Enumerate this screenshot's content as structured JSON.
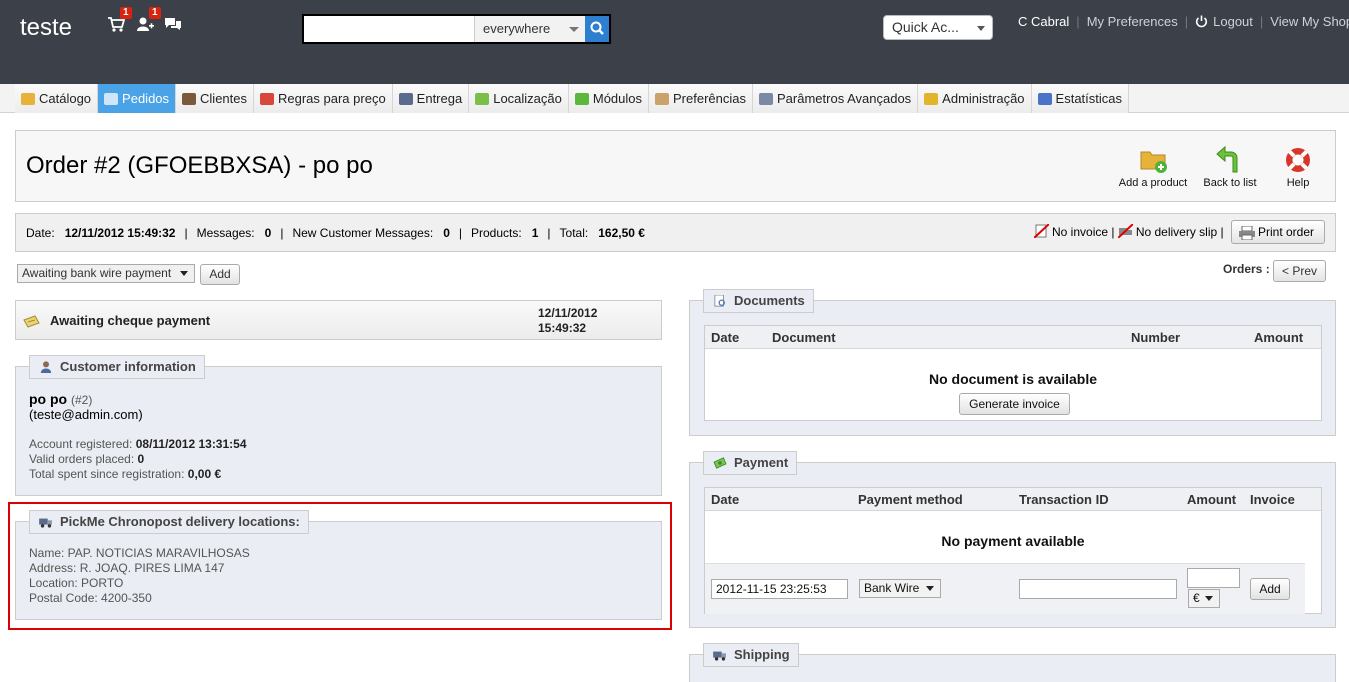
{
  "header": {
    "shop_name": "teste",
    "orders_badge": "1",
    "customers_badge": "1",
    "search": {
      "value": "",
      "scope": "everywhere"
    },
    "quick_access": "Quick Ac...",
    "employee": "C Cabral",
    "my_preferences": "My Preferences",
    "logout": "Logout",
    "view_shop": "View My Shop"
  },
  "nav": {
    "items": [
      {
        "label": "Catálogo",
        "icon": "folder-icon",
        "color": "#e8b13a"
      },
      {
        "label": "Pedidos",
        "icon": "cart-icon",
        "color": "#cfe6fa"
      },
      {
        "label": "Clientes",
        "icon": "user-icon",
        "color": "#7a5a3a"
      },
      {
        "label": "Regras para preço",
        "icon": "price-rule-icon",
        "color": "#d9463a"
      },
      {
        "label": "Entrega",
        "icon": "truck-icon",
        "color": "#5a6a8a"
      },
      {
        "label": "Localização",
        "icon": "globe-icon",
        "color": "#7bbf4a"
      },
      {
        "label": "Módulos",
        "icon": "puzzle-icon",
        "color": "#5cb83c"
      },
      {
        "label": "Preferências",
        "icon": "preferences-icon",
        "color": "#c9a36a"
      },
      {
        "label": "Parâmetros Avançados",
        "icon": "wrench-icon",
        "color": "#7a8aa6"
      },
      {
        "label": "Administração",
        "icon": "key-icon",
        "color": "#e1b42b"
      },
      {
        "label": "Estatísticas",
        "icon": "chart-icon",
        "color": "#4a72c8"
      }
    ],
    "active_index": 1
  },
  "page": {
    "title": "Order #2 (GFOEBBXSA) - po po",
    "toolbar": {
      "add_product": "Add a product",
      "back_to_list": "Back to list",
      "help": "Help"
    }
  },
  "summary": {
    "date_label": "Date:",
    "date": "12/11/2012 15:49:32",
    "messages_label": "Messages:",
    "messages": "0",
    "new_messages_label": "New Customer Messages:",
    "new_messages": "0",
    "products_label": "Products:",
    "products": "1",
    "total_label": "Total:",
    "total": "162,50 €",
    "no_invoice": "No invoice",
    "no_delivery_slip": "No delivery slip",
    "print_order": "Print order"
  },
  "status": {
    "selected": "Awaiting bank wire payment",
    "add": "Add",
    "orders_label": "Orders",
    "prev": "< Prev"
  },
  "history": {
    "status": "Awaiting cheque payment",
    "date_line1": "12/11/2012",
    "date_line2": "15:49:32"
  },
  "customer": {
    "legend": "Customer information",
    "name": "po po",
    "id": "(#2)",
    "email": "teste@admin.com",
    "account_registered_label": "Account registered:",
    "account_registered": "08/11/2012 13:31:54",
    "valid_orders_label": "Valid orders placed:",
    "valid_orders": "0",
    "total_spent_label": "Total spent since registration:",
    "total_spent": "0,00 €"
  },
  "pickme": {
    "legend": "PickMe Chronopost delivery locations:",
    "name": "Name: PAP. NOTICIAS MARAVILHOSAS",
    "address": "Address: R. JOAQ. PIRES LIMA 147",
    "location": "Location: PORTO",
    "postal_code": "Postal Code: 4200-350"
  },
  "documents": {
    "legend": "Documents",
    "columns": [
      "Date",
      "Document",
      "Number",
      "Amount"
    ],
    "empty": "No document is available",
    "generate_invoice": "Generate invoice"
  },
  "payment": {
    "legend": "Payment",
    "columns": [
      "Date",
      "Payment method",
      "Transaction ID",
      "Amount",
      "Invoice"
    ],
    "empty": "No payment available",
    "date_value": "2012-11-15 23:25:53",
    "method": "Bank Wire",
    "transaction_id": "",
    "amount": "",
    "currency": "€",
    "add": "Add"
  },
  "shipping": {
    "legend": "Shipping"
  }
}
